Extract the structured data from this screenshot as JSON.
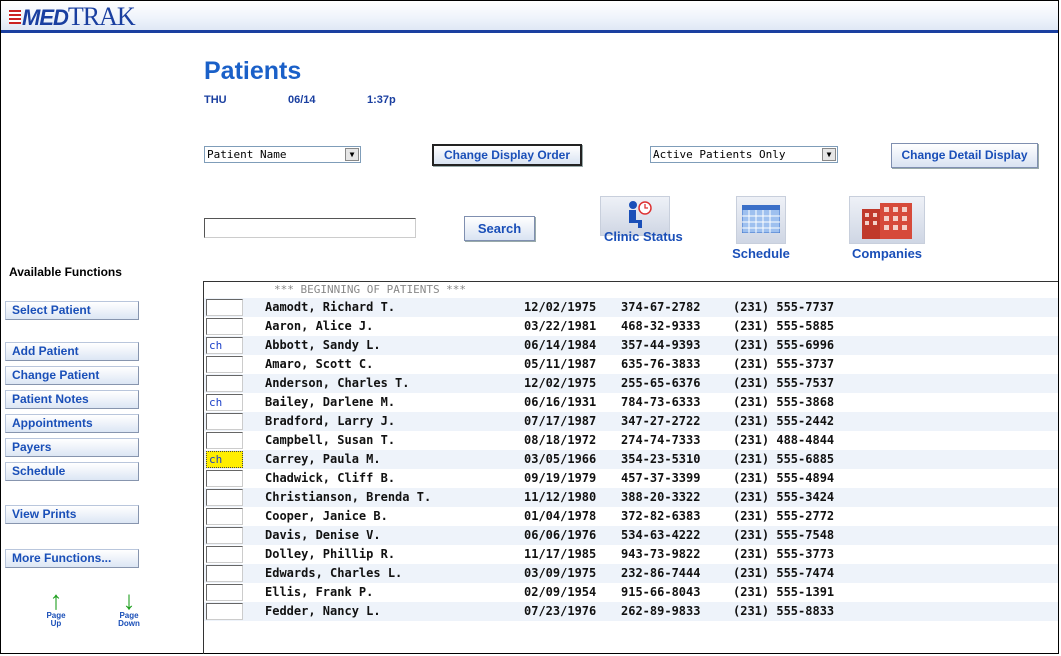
{
  "app": {
    "logo_prefix": "MED",
    "logo_suffix": "TRAK"
  },
  "header": {
    "title": "Patients",
    "day": "THU",
    "date": "06/14",
    "time": "1:37p"
  },
  "controls": {
    "sort_select": "Patient Name",
    "change_order_label": "Change Display Order",
    "filter_select": "Active Patients Only",
    "change_detail_label": "Change Detail Display",
    "search_value": "",
    "search_label": "Search"
  },
  "tiles": [
    {
      "label": "Clinic Status",
      "icon": "clinic-status-icon"
    },
    {
      "label": "Schedule",
      "icon": "schedule-calendar-icon"
    },
    {
      "label": "Companies",
      "icon": "companies-building-icon"
    }
  ],
  "sidebar": {
    "heading": "Available Functions",
    "items": [
      "Select Patient",
      "Add Patient",
      "Change Patient",
      "Patient Notes",
      "Appointments",
      "Payers",
      "Schedule",
      "View Prints",
      "More Functions..."
    ],
    "page_up": "Page Up",
    "page_down": "Page Down"
  },
  "list": {
    "header": "*** BEGINNING OF PATIENTS ***",
    "rows": [
      {
        "code": "",
        "name": "Aamodt, Richard T.",
        "dob": "12/02/1975",
        "ssn": "374-67-2782",
        "phone": "(231) 555-7737"
      },
      {
        "code": "",
        "name": "Aaron, Alice J.",
        "dob": "03/22/1981",
        "ssn": "468-32-9333",
        "phone": "(231) 555-5885"
      },
      {
        "code": "ch",
        "name": "Abbott, Sandy L.",
        "dob": "06/14/1984",
        "ssn": "357-44-9393",
        "phone": "(231) 555-6996"
      },
      {
        "code": "",
        "name": "Amaro, Scott C.",
        "dob": "05/11/1987",
        "ssn": "635-76-3833",
        "phone": "(231) 555-3737"
      },
      {
        "code": "",
        "name": "Anderson, Charles T.",
        "dob": "12/02/1975",
        "ssn": "255-65-6376",
        "phone": "(231) 555-7537"
      },
      {
        "code": "ch",
        "name": "Bailey, Darlene M.",
        "dob": "06/16/1931",
        "ssn": "784-73-6333",
        "phone": "(231) 555-3868"
      },
      {
        "code": "",
        "name": "Bradford, Larry J.",
        "dob": "07/17/1987",
        "ssn": "347-27-2722",
        "phone": "(231) 555-2442"
      },
      {
        "code": "",
        "name": "Campbell, Susan T.",
        "dob": "08/18/1972",
        "ssn": "274-74-7333",
        "phone": "(231) 488-4844"
      },
      {
        "code": "ch",
        "name": "Carrey, Paula M.",
        "dob": "03/05/1966",
        "ssn": "354-23-5310",
        "phone": "(231) 555-6885"
      },
      {
        "code": "",
        "name": "Chadwick, Cliff B.",
        "dob": "09/19/1979",
        "ssn": "457-37-3399",
        "phone": "(231) 555-4894"
      },
      {
        "code": "",
        "name": "Christianson, Brenda T.",
        "dob": "11/12/1980",
        "ssn": "388-20-3322",
        "phone": "(231) 555-3424"
      },
      {
        "code": "",
        "name": "Cooper, Janice B.",
        "dob": "01/04/1978",
        "ssn": "372-82-6383",
        "phone": "(231) 555-2772"
      },
      {
        "code": "",
        "name": "Davis, Denise V.",
        "dob": "06/06/1976",
        "ssn": "534-63-4222",
        "phone": "(231) 555-7548"
      },
      {
        "code": "",
        "name": "Dolley, Phillip R.",
        "dob": "11/17/1985",
        "ssn": "943-73-9822",
        "phone": "(231) 555-3773"
      },
      {
        "code": "",
        "name": "Edwards, Charles L.",
        "dob": "03/09/1975",
        "ssn": "232-86-7444",
        "phone": "(231) 555-7474"
      },
      {
        "code": "",
        "name": "Ellis, Frank P.",
        "dob": "02/09/1954",
        "ssn": "915-66-8043",
        "phone": "(231) 555-1391"
      },
      {
        "code": "",
        "name": "Fedder, Nancy L.",
        "dob": "07/23/1976",
        "ssn": "262-89-9833",
        "phone": "(231) 555-8833"
      }
    ]
  },
  "colors": {
    "accent": "#1a4fb8",
    "highlight": "#ffee00",
    "row_alt": "#eef3fa"
  }
}
